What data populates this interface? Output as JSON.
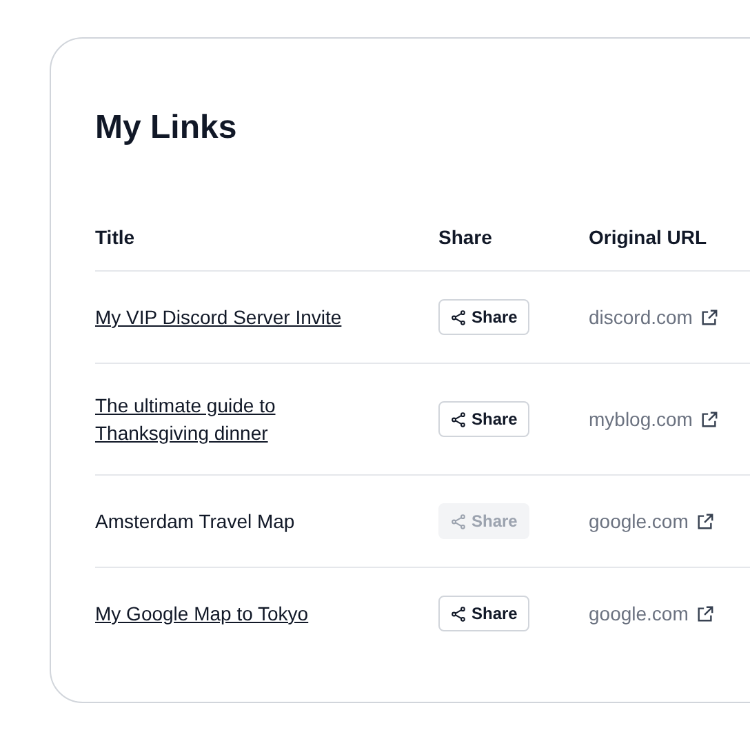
{
  "heading": "My Links",
  "columns": [
    "Title",
    "Share",
    "Original URL"
  ],
  "rows": [
    {
      "title": "My VIP Discord Server Invite",
      "link": true,
      "share": {
        "label": "Share",
        "disabled": false
      },
      "url": "discord.com"
    },
    {
      "title": "The ultimate guide to Thanksgiving dinner",
      "link": true,
      "share": {
        "label": "Share",
        "disabled": false
      },
      "url": "myblog.com"
    },
    {
      "title": "Amsterdam Travel Map",
      "link": false,
      "share": {
        "label": "Share",
        "disabled": true
      },
      "url": "google.com"
    },
    {
      "title": "My Google Map to Tokyo",
      "link": true,
      "share": {
        "label": "Share",
        "disabled": false
      },
      "url": "google.com"
    }
  ]
}
